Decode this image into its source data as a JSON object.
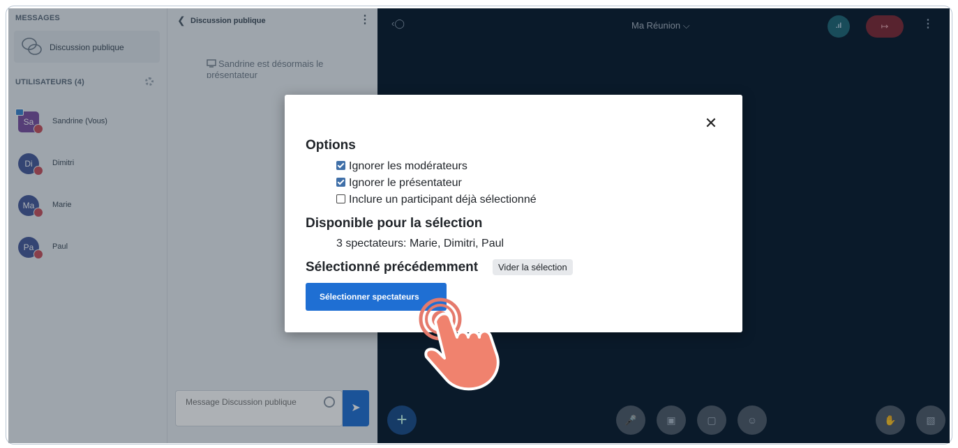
{
  "sidebar": {
    "messages_title": "MESSAGES",
    "public_chat_label": "Discussion publique",
    "users_title": "UTILISATEURS (4)",
    "users": [
      {
        "initials": "Sa",
        "name": "Sandrine (Vous)"
      },
      {
        "initials": "Di",
        "name": "Dimitri"
      },
      {
        "initials": "Ma",
        "name": "Marie"
      },
      {
        "initials": "Pa",
        "name": "Paul"
      }
    ]
  },
  "chat": {
    "title": "Discussion publique",
    "system_message": "Sandrine est désormais le présentateur",
    "input_placeholder": "Message Discussion publique"
  },
  "main": {
    "room_name": "Ma Réunion ⌵",
    "colors": {
      "background": "#06172a",
      "leave": "#7d2532",
      "primary": "#1f6fd3"
    }
  },
  "modal": {
    "options_heading": "Options",
    "options": [
      {
        "label": "Ignorer les modérateurs",
        "checked": true
      },
      {
        "label": "Ignorer le présentateur",
        "checked": true
      },
      {
        "label": "Inclure un participant déjà sélectionné",
        "checked": false
      }
    ],
    "available_heading": "Disponible pour la sélection",
    "available_text": "3 spectateurs: Marie, Dimitri, Paul",
    "previous_heading": "Sélectionné précédemment",
    "clear_label": "Vider la sélection",
    "select_label": "Sélectionner spectateurs"
  },
  "icons": [
    "chat-bubble-icon",
    "gear-icon",
    "back-chevron-icon",
    "kebab-menu-icon",
    "screen-icon",
    "emoji-icon",
    "send-icon",
    "user-icon",
    "network-icon",
    "leave-icon",
    "plus-icon",
    "mic-off-icon",
    "camera-off-icon",
    "screenshare-off-icon",
    "reaction-icon",
    "raise-hand-icon",
    "presentation-icon",
    "close-icon",
    "pointer-hand-icon"
  ]
}
